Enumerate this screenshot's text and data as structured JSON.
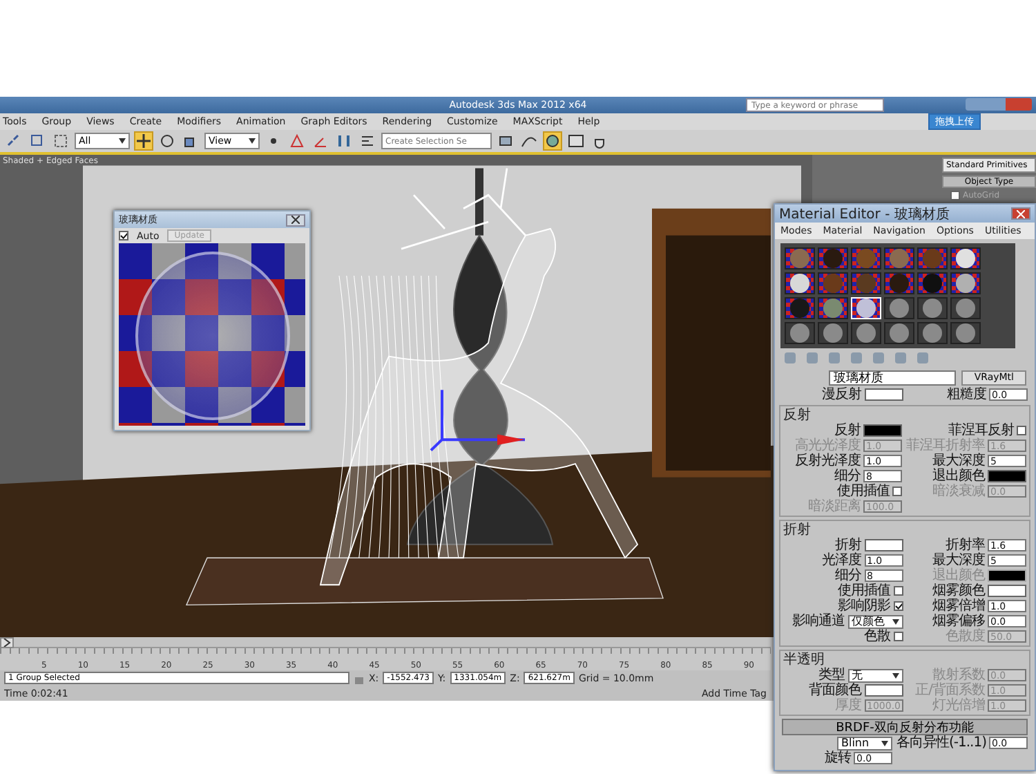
{
  "title_bar": {
    "title": "Autodesk 3ds Max 2012 x64",
    "search": {
      "placeholder": "Type a keyword or phrase"
    }
  },
  "menu_bar": [
    "Tools",
    "Group",
    "Views",
    "Create",
    "Modifiers",
    "Animation",
    "Graph Editors",
    "Rendering",
    "Customize",
    "MAXScript",
    "Help"
  ],
  "toolbar": {
    "selection_filter": "All",
    "reference_coord": "View",
    "named_selection": {
      "placeholder": "Create Selection Se"
    },
    "tools": [
      {
        "kind": "link",
        "selected": false
      },
      {
        "kind": "select",
        "selected": false
      },
      {
        "kind": "region",
        "selected": false
      },
      {
        "kind": "move",
        "selected": true
      },
      {
        "kind": "rotate",
        "selected": false
      },
      {
        "kind": "scale",
        "selected": false
      },
      {
        "kind": "pivot",
        "selected": false
      },
      {
        "kind": "snap",
        "selected": false
      },
      {
        "kind": "angle",
        "selected": false
      },
      {
        "kind": "mirror",
        "selected": false
      },
      {
        "kind": "align",
        "selected": false
      },
      {
        "kind": "layer",
        "selected": false
      },
      {
        "kind": "curve",
        "selected": false
      },
      {
        "kind": "render",
        "selected": true
      },
      {
        "kind": "frame",
        "selected": false
      },
      {
        "kind": "teapot",
        "selected": false
      }
    ]
  },
  "upload_button": "拖拽上传",
  "viewport": {
    "label": "Shaded + Edged Faces"
  },
  "preview_window": {
    "title": "玻璃材质",
    "auto": {
      "label": "Auto",
      "checked": true
    },
    "update": {
      "label": "Update",
      "disabled": true
    }
  },
  "command_panel": {
    "category": "Standard Primitives",
    "rollout": "Object Type",
    "autogrid": {
      "label": "AutoGrid",
      "checked": false
    }
  },
  "material_editor": {
    "title": "Material Editor - 玻璃材质",
    "menus": [
      "Modes",
      "Material",
      "Navigation",
      "Options",
      "Utilities"
    ],
    "slots": [
      {
        "kind": "checker",
        "color": "#8a6a50",
        "selected": false
      },
      {
        "kind": "checker",
        "color": "#2a1a10",
        "selected": false
      },
      {
        "kind": "checker",
        "color": "#7a4a20",
        "selected": false
      },
      {
        "kind": "checker",
        "color": "#8a6a50",
        "selected": false
      },
      {
        "kind": "checker",
        "color": "#6a3a1a",
        "selected": false
      },
      {
        "kind": "checker",
        "color": "#e0e0e0",
        "selected": false
      },
      {
        "kind": "checker",
        "color": "#d8d8d8",
        "selected": false
      },
      {
        "kind": "checker",
        "color": "#6a3a1a",
        "selected": false
      },
      {
        "kind": "checker",
        "color": "#5a3a20",
        "selected": false
      },
      {
        "kind": "checker",
        "color": "#2a1a10",
        "selected": false
      },
      {
        "kind": "checker",
        "color": "#101010",
        "selected": false
      },
      {
        "kind": "checker",
        "color": "#b0b0b0",
        "selected": false
      },
      {
        "kind": "checker",
        "color": "#181818",
        "selected": false
      },
      {
        "kind": "checker",
        "color": "#7a8a70",
        "selected": false
      },
      {
        "kind": "checker",
        "color": "#c0c0d8",
        "selected": true
      },
      {
        "kind": "plain",
        "color": "#8a8a8a",
        "selected": false
      },
      {
        "kind": "plain",
        "color": "#8a8a8a",
        "selected": false
      },
      {
        "kind": "plain",
        "color": "#8a8a8a",
        "selected": false
      },
      {
        "kind": "plain",
        "color": "#8a8a8a",
        "selected": false
      },
      {
        "kind": "plain",
        "color": "#8a8a8a",
        "selected": false
      },
      {
        "kind": "plain",
        "color": "#8a8a8a",
        "selected": false
      },
      {
        "kind": "plain",
        "color": "#8a8a8a",
        "selected": false
      },
      {
        "kind": "plain",
        "color": "#8a8a8a",
        "selected": false
      },
      {
        "kind": "plain",
        "color": "#8a8a8a",
        "selected": false
      }
    ],
    "name": "玻璃材质",
    "type": "VRayMtl",
    "sections": [
      {
        "kind": "plain",
        "fields": [
          {
            "label": "漫反射",
            "kind": "color",
            "color": "#ffffff",
            "disabled": false
          },
          {
            "label": "粗糙度",
            "kind": "number",
            "value": "0.0",
            "disabled": false
          }
        ]
      },
      {
        "kind": "group",
        "title": "反射",
        "fields": [
          {
            "label": "反射",
            "kind": "color",
            "color": "#000000",
            "disabled": false
          },
          {
            "label": "菲涅耳反射",
            "kind": "check",
            "checked": false,
            "disabled": false
          },
          {
            "label": "高光光泽度",
            "kind": "number",
            "value": "1.0",
            "disabled": true
          },
          {
            "label": "菲涅耳折射率",
            "kind": "number",
            "value": "1.6",
            "disabled": true
          },
          {
            "label": "反射光泽度",
            "kind": "number",
            "value": "1.0",
            "disabled": false
          },
          {
            "label": "最大深度",
            "kind": "number",
            "value": "5",
            "disabled": false
          },
          {
            "label": "细分",
            "kind": "number",
            "value": "8",
            "disabled": false
          },
          {
            "label": "退出颜色",
            "kind": "color",
            "color": "#000000",
            "disabled": false
          },
          {
            "label": "使用插值",
            "kind": "check",
            "checked": false,
            "disabled": false
          },
          {
            "label": "暗淡衰减",
            "kind": "number",
            "value": "0.0",
            "disabled": true
          },
          {
            "label": "暗淡距离",
            "kind": "number",
            "value": "100.0",
            "disabled": true
          }
        ]
      },
      {
        "kind": "group",
        "title": "折射",
        "fields": [
          {
            "label": "折射",
            "kind": "color",
            "color": "#ffffff",
            "disabled": false
          },
          {
            "label": "折射率",
            "kind": "number",
            "value": "1.6",
            "disabled": false
          },
          {
            "label": "光泽度",
            "kind": "number",
            "value": "1.0",
            "disabled": false
          },
          {
            "label": "最大深度",
            "kind": "number",
            "value": "5",
            "disabled": false
          },
          {
            "label": "细分",
            "kind": "number",
            "value": "8",
            "disabled": false
          },
          {
            "label": "退出颜色",
            "kind": "color",
            "color": "#000000",
            "disabled": true
          },
          {
            "label": "使用插值",
            "kind": "check",
            "checked": false,
            "disabled": false
          },
          {
            "label": "烟雾颜色",
            "kind": "color",
            "color": "#ffffff",
            "disabled": false
          },
          {
            "label": "影响阴影",
            "kind": "check",
            "checked": true,
            "disabled": false
          },
          {
            "label": "烟雾倍增",
            "kind": "number",
            "value": "1.0",
            "disabled": false
          },
          {
            "label": "影响通道",
            "kind": "dropdown",
            "value": "仅颜色",
            "disabled": false
          },
          {
            "label": "烟雾偏移",
            "kind": "number",
            "value": "0.0",
            "disabled": false
          },
          {
            "label": "色散",
            "kind": "check",
            "checked": false,
            "disabled": false
          },
          {
            "label": "色散度",
            "kind": "number",
            "value": "50.0",
            "disabled": true
          }
        ]
      },
      {
        "kind": "group",
        "title": "半透明",
        "fields": [
          {
            "label": "类型",
            "kind": "dropdown",
            "value": "无",
            "disabled": false
          },
          {
            "label": "散射系数",
            "kind": "number",
            "value": "0.0",
            "disabled": true
          },
          {
            "label": "背面颜色",
            "kind": "color",
            "color": "#ffffff",
            "disabled": false
          },
          {
            "label": "正/背面系数",
            "kind": "number",
            "value": "1.0",
            "disabled": true
          },
          {
            "label": "厚度",
            "kind": "number",
            "value": "1000.0",
            "disabled": true
          },
          {
            "label": "灯光倍增",
            "kind": "number",
            "value": "1.0",
            "disabled": true
          }
        ]
      },
      {
        "kind": "rollout",
        "title": "BRDF-双向反射分布功能",
        "fields": [
          {
            "kind": "dropdown",
            "value": "Blinn",
            "disabled": false
          },
          {
            "label": "各向异性(-1..1)",
            "kind": "number",
            "value": "0.0",
            "disabled": false
          },
          {
            "label": "旋转",
            "kind": "number",
            "value": "0.0",
            "disabled": false
          }
        ]
      }
    ]
  },
  "timeline": {
    "ticks": [
      "5",
      "10",
      "15",
      "20",
      "25",
      "30",
      "35",
      "40",
      "45",
      "50",
      "55",
      "60",
      "65",
      "70",
      "75",
      "80",
      "85",
      "90"
    ]
  },
  "status_bar": {
    "selection": "1 Group Selected",
    "coordinates": [
      {
        "axis": "X:",
        "value": "-1552.473"
      },
      {
        "axis": "Y:",
        "value": "1331.054m"
      },
      {
        "axis": "Z:",
        "value": "621.627m"
      }
    ],
    "grid": "Grid = 10.0mm",
    "time": "Time  0:02:41",
    "time_tag": "Add Time Tag"
  }
}
